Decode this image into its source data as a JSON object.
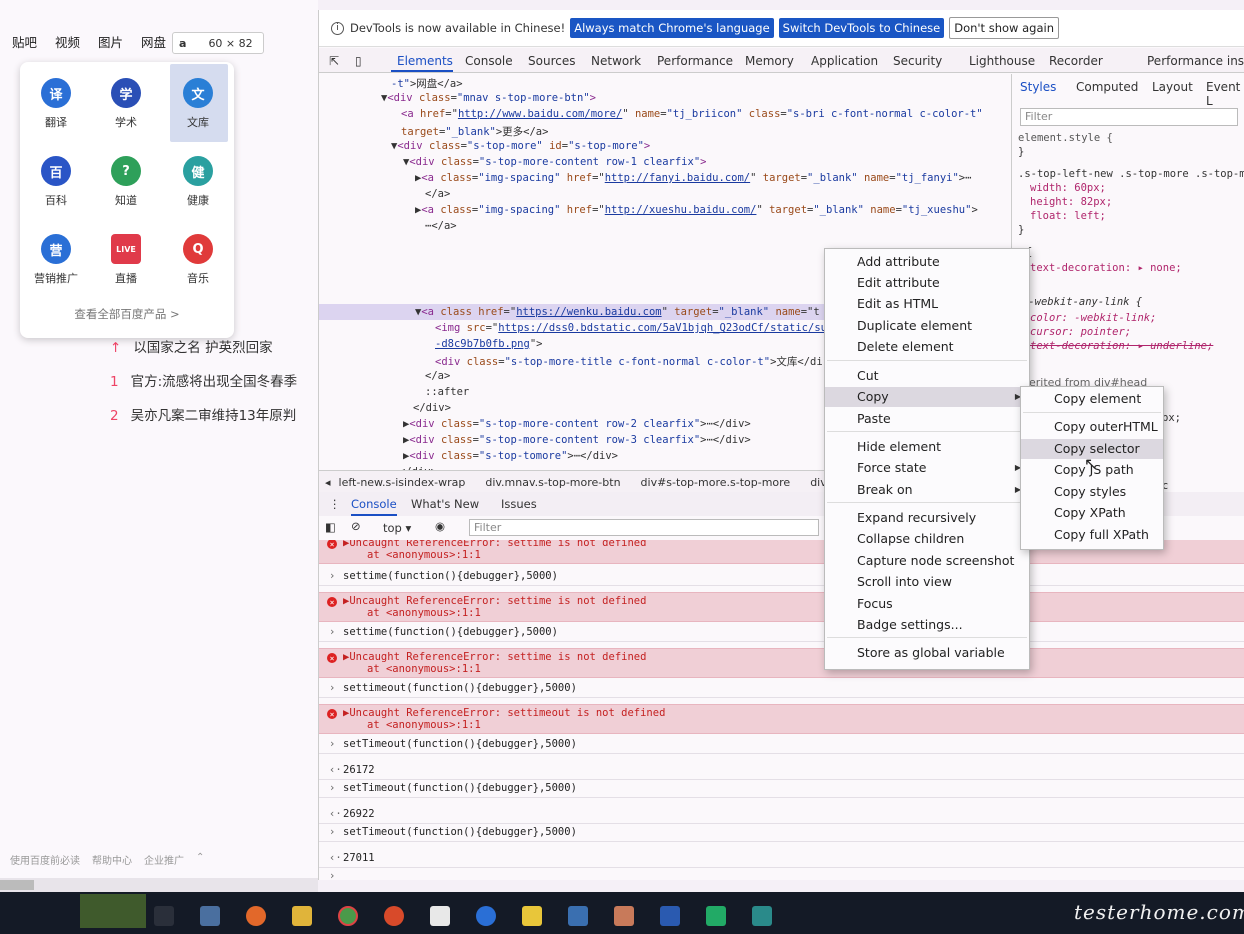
{
  "left_page": {
    "nav": [
      "贴吧",
      "视频",
      "图片",
      "网盘"
    ],
    "size_tip": {
      "tag": "a",
      "size": "60 × 82"
    },
    "more_items": [
      {
        "label": "翻译",
        "icon": "translate-icon",
        "color": "#2a6fd6",
        "glyph": "译"
      },
      {
        "label": "学术",
        "icon": "academic-icon",
        "color": "#2a4fb6",
        "glyph": "学"
      },
      {
        "label": "文库",
        "icon": "wenku-icon",
        "color": "#2a7fd6",
        "glyph": "文"
      },
      {
        "label": "百科",
        "icon": "baike-icon",
        "color": "#2a55c6",
        "glyph": "百"
      },
      {
        "label": "知道",
        "icon": "zhidao-icon",
        "color": "#2ea05a",
        "glyph": "?"
      },
      {
        "label": "健康",
        "icon": "health-icon",
        "color": "#2aa0a0",
        "glyph": "健"
      },
      {
        "label": "营销推广",
        "icon": "marketing-icon",
        "color": "#2a6fd6",
        "glyph": "营"
      },
      {
        "label": "直播",
        "icon": "live-icon",
        "color": "#e03a4a",
        "glyph": "LIVE"
      },
      {
        "label": "音乐",
        "icon": "music-icon",
        "color": "#e03a3a",
        "glyph": "Q"
      }
    ],
    "all_products": "查看全部百度产品 >",
    "hot_list": [
      {
        "rank": "↑",
        "text": "以国家之名 护英烈回家"
      },
      {
        "rank": "1",
        "text": "官方:流感将出现全国冬春季"
      },
      {
        "rank": "2",
        "text": "吴亦凡案二审维持13年原判"
      }
    ],
    "footer": [
      "使用百度前必读",
      "帮助中心",
      "企业推广"
    ]
  },
  "devtools": {
    "info_bar": {
      "message": "DevTools is now available in Chinese!",
      "btn_match": "Always match Chrome's language",
      "btn_switch": "Switch DevTools to Chinese",
      "btn_dismiss": "Don't show again"
    },
    "tabs": [
      "Elements",
      "Console",
      "Sources",
      "Network",
      "Performance",
      "Memory",
      "Application",
      "Security",
      "Lighthouse",
      "Recorder",
      "Performance insigh"
    ],
    "breadcrumb": [
      "left-new.s-isindex-wrap",
      "div.mnav.s-top-more-btn",
      "div#s-top-more.s-top-more",
      "div.s-top-m"
    ],
    "styles": {
      "tabs": [
        "Styles",
        "Computed",
        "Layout",
        "Event L"
      ],
      "filter": "Filter",
      "rule1": "element.style {",
      "rule1_close": "}",
      "rule2_selector": ".s-top-left-new .s-top-more .s-top-m",
      "rule2_props": [
        "width: 60px;",
        "height: 82px;",
        "float: left;"
      ],
      "rule2_close": "}",
      "rule3_open": "{",
      "rule3_prop": "text-decoration: ▸ none;",
      "rule4_selector": ":-webkit-any-link {",
      "rule4_props": [
        "color: -webkit-link;",
        "cursor: pointer;",
        "text-decoration: ▸ underline;"
      ],
      "rule4_close": "}",
      "inherited": "herited from div#head",
      "frag_px": "px;",
      "frag_c": "c"
    },
    "console": {
      "tabs": [
        "Console",
        "What's New",
        "Issues"
      ],
      "context": "top",
      "filter": "Filter",
      "lines": [
        {
          "kind": "err",
          "text": "▶Uncaught ReferenceError: settime is not defined",
          "sub": "at <anonymous>:1:1"
        },
        {
          "kind": "in",
          "text": "settime(function(){debugger},5000)"
        },
        {
          "kind": "err",
          "text": "▶Uncaught ReferenceError: settime is not defined",
          "sub": "at <anonymous>:1:1"
        },
        {
          "kind": "in",
          "text": "settime(function(){debugger},5000)"
        },
        {
          "kind": "err",
          "text": "▶Uncaught ReferenceError: settime is not defined",
          "sub": "at <anonymous>:1:1"
        },
        {
          "kind": "in",
          "text": "settimeout(function(){debugger},5000)"
        },
        {
          "kind": "err",
          "text": "▶Uncaught ReferenceError: settimeout is not defined",
          "sub": "at <anonymous>:1:1"
        },
        {
          "kind": "in",
          "text": "setTimeout(function(){debugger},5000)"
        },
        {
          "kind": "out",
          "text": "26172"
        },
        {
          "kind": "in",
          "text": "setTimeout(function(){debugger},5000)"
        },
        {
          "kind": "out",
          "text": "26922"
        },
        {
          "kind": "in",
          "text": "setTimeout(function(){debugger},5000)"
        },
        {
          "kind": "out",
          "text": "27011"
        }
      ]
    }
  },
  "context_menu": {
    "items": [
      "Add attribute",
      "Edit attribute",
      "Edit as HTML",
      "Duplicate element",
      "Delete element",
      "Cut",
      "Copy",
      "Paste",
      "Hide element",
      "Force state",
      "Break on",
      "Expand recursively",
      "Collapse children",
      "Capture node screenshot",
      "Scroll into view",
      "Focus",
      "Badge settings...",
      "Store as global variable"
    ]
  },
  "copy_submenu": {
    "items": [
      "Copy element",
      "Copy outerHTML",
      "Copy selector",
      "Copy JS path",
      "Copy styles",
      "Copy XPath",
      "Copy full XPath"
    ]
  },
  "watermark": "testerhome.com",
  "colors": {
    "accent": "#1a4fc4",
    "error_bg": "#f0cfd6",
    "selected_row": "#dcd4f0"
  }
}
